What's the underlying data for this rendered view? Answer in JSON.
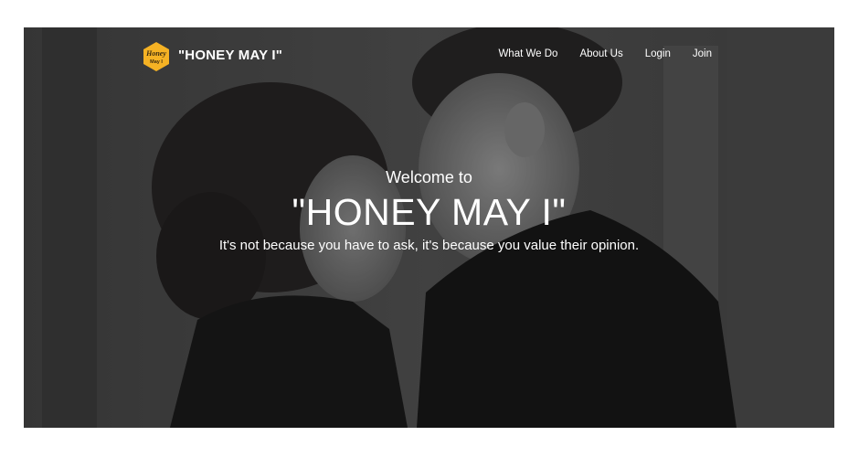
{
  "brand": {
    "logo_text_top": "Honey",
    "logo_text_bottom": "May I",
    "name": "\"HONEY MAY I\"",
    "logo_color": "#f5b224"
  },
  "nav": {
    "items": [
      {
        "label": "What We Do"
      },
      {
        "label": "About Us"
      },
      {
        "label": "Login"
      },
      {
        "label": "Join"
      }
    ]
  },
  "hero": {
    "welcome": "Welcome to",
    "title": "\"HONEY MAY I\"",
    "subtitle": "It's not because you have to ask, it's because you value their opinion."
  }
}
